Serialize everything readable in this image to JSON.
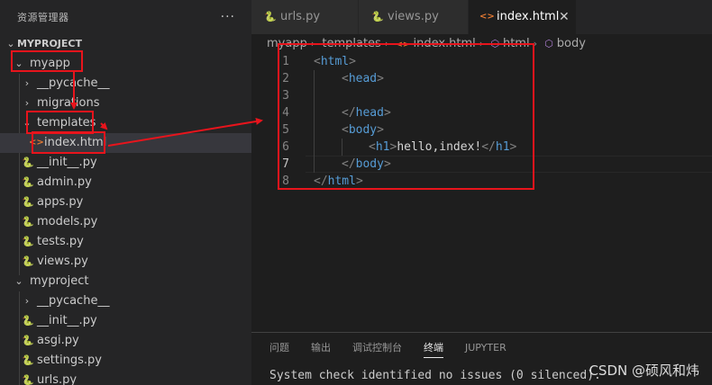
{
  "sidebar": {
    "title": "资源管理器",
    "more": "···",
    "items": [
      {
        "label": "MYPROJECT",
        "kind": "root",
        "chevron": "⌄"
      },
      {
        "label": "myapp",
        "kind": "folder",
        "chevron": "⌄"
      },
      {
        "label": "__pycache__",
        "kind": "folder",
        "chevron": "›"
      },
      {
        "label": "migrations",
        "kind": "folder",
        "chevron": "›"
      },
      {
        "label": "templates",
        "kind": "folder",
        "chevron": "⌄"
      },
      {
        "label": "index.html",
        "kind": "html",
        "icon": "<>",
        "selected": true
      },
      {
        "label": "__init__.py",
        "kind": "py",
        "icon": "🐍"
      },
      {
        "label": "admin.py",
        "kind": "py",
        "icon": "🐍"
      },
      {
        "label": "apps.py",
        "kind": "py",
        "icon": "🐍"
      },
      {
        "label": "models.py",
        "kind": "py",
        "icon": "🐍"
      },
      {
        "label": "tests.py",
        "kind": "py",
        "icon": "🐍"
      },
      {
        "label": "views.py",
        "kind": "py",
        "icon": "🐍"
      },
      {
        "label": "myproject",
        "kind": "folder",
        "chevron": "⌄"
      },
      {
        "label": "__pycache__",
        "kind": "folder",
        "chevron": "›"
      },
      {
        "label": "__init__.py",
        "kind": "py",
        "icon": "🐍"
      },
      {
        "label": "asgi.py",
        "kind": "py",
        "icon": "🐍"
      },
      {
        "label": "settings.py",
        "kind": "py",
        "icon": "🐍"
      },
      {
        "label": "urls.py",
        "kind": "py",
        "icon": "🐍"
      }
    ]
  },
  "tabs": [
    {
      "label": "urls.py",
      "icon": "🐍"
    },
    {
      "label": "views.py",
      "icon": "🐍"
    },
    {
      "label": "index.html",
      "icon": "<>",
      "active": true,
      "close": "✕"
    }
  ],
  "breadcrumb": [
    "myapp",
    "templates",
    "index.html",
    "html",
    "body"
  ],
  "breadcrumb_sep": "›",
  "code": {
    "lines": [
      "1",
      "2",
      "3",
      "4",
      "5",
      "6",
      "7",
      "8"
    ],
    "tokens": {
      "l1_open": "<",
      "l1_tag": "html",
      "l1_close": ">",
      "l2_open": "<",
      "l2_tag": "head",
      "l2_close": ">",
      "l4_open": "</",
      "l4_tag": "head",
      "l4_close": ">",
      "l5_open": "<",
      "l5_tag": "body",
      "l5_close": ">",
      "l6_open": "<",
      "l6_tag": "h1",
      "l6_close": ">",
      "l6_text": "hello,index!",
      "l6_eopen": "</",
      "l6_etag": "h1",
      "l6_eclose": ">",
      "l7_open": "</",
      "l7_tag": "body",
      "l7_close": ">",
      "l8_open": "</",
      "l8_tag": "html",
      "l8_close": ">"
    }
  },
  "panel": {
    "tabs": [
      "问题",
      "输出",
      "调试控制台",
      "终端",
      "JUPYTER"
    ],
    "active_tab": "终端",
    "output": "System check identified no issues (0 silenced)."
  },
  "watermark": "CSDN @硕风和炜",
  "colors": {
    "annotation": "#e8141c",
    "html_icon": "#e37933",
    "py_icon": "#519aba",
    "tag": "#569cd6"
  }
}
